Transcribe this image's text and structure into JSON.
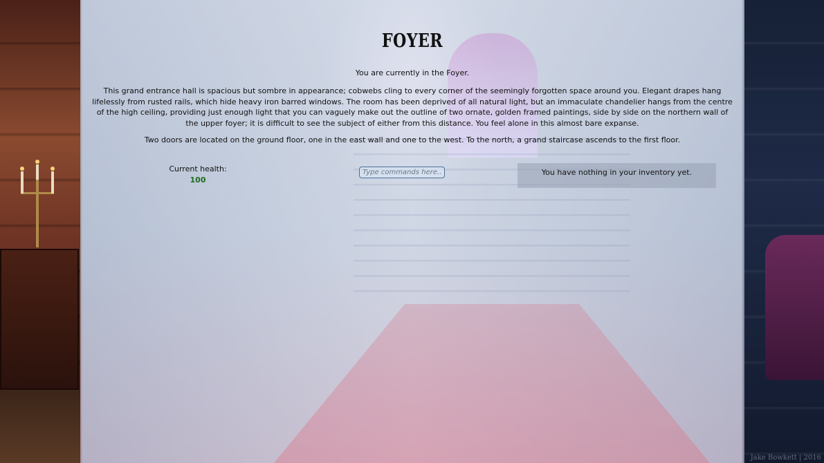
{
  "room": {
    "title": "FOYER",
    "location_text": "You are currently in the Foyer.",
    "description": "This grand entrance hall is spacious but sombre in appearance; cobwebs cling to every corner of the seemingly forgotten space around you. Elegant drapes hang lifelessly from rusted rails, which hide heavy iron barred windows. The room has been deprived of all natural light, but an immaculate chandelier hangs from the centre of the high ceiling, providing just enough light that you can vaguely make out the outline of two ornate, golden framed paintings, side by side on the northern wall of the upper foyer; it is difficult to see the subject of either from this distance. You feel alone in this almost bare expanse.",
    "exits": "Two doors are located on the ground floor, one in the east wall and one to the west. To the north, a grand staircase ascends to the first floor."
  },
  "status": {
    "health_label": "Current health:",
    "health_value": "100"
  },
  "command": {
    "placeholder": "Type commands here..."
  },
  "inventory": {
    "empty_text": "You have nothing in your inventory yet."
  },
  "credit": "Jake Bowkett | 2016",
  "colors": {
    "health_value": "#1f6b1f",
    "input_border": "#4a6f96",
    "panel_overlay": "#dde2ee"
  }
}
